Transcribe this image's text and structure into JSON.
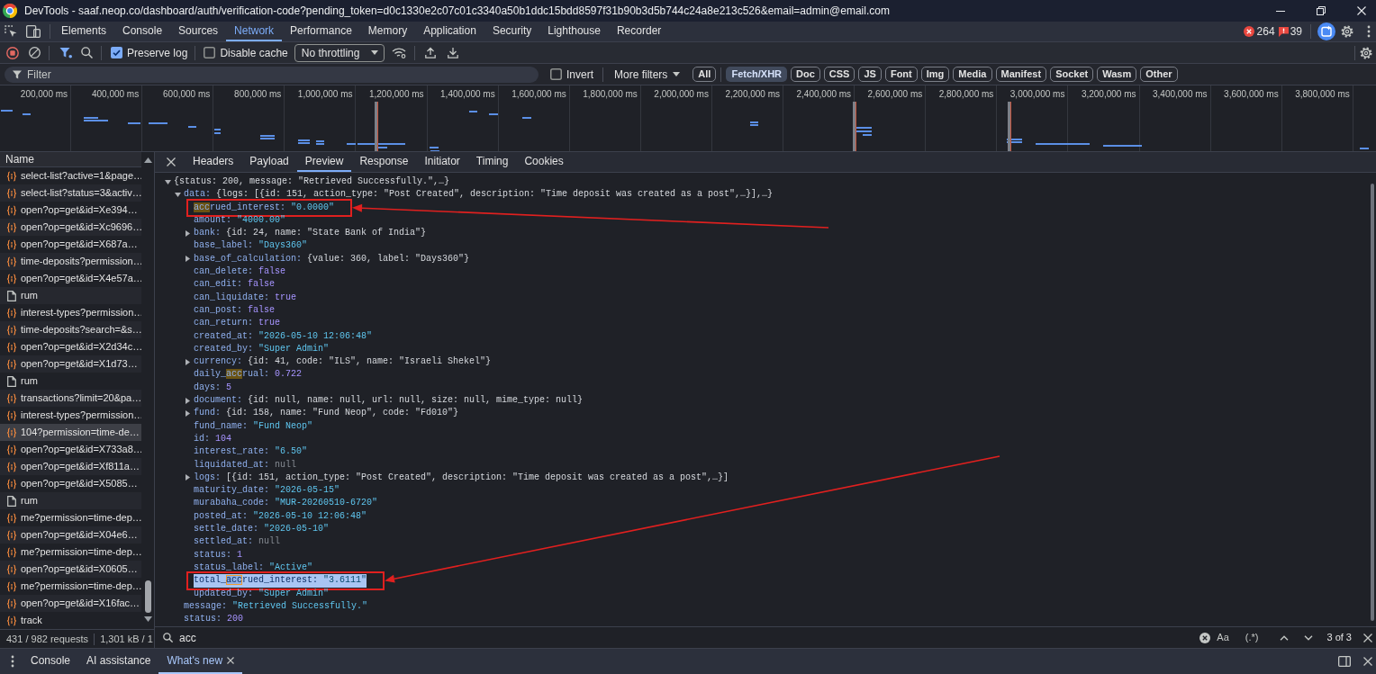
{
  "window": {
    "title": "DevTools - saaf.neop.co/dashboard/auth/verification-code?pending_token=d0c1330e2c07c01c3340a50b1ddc15bdd8597f31b90b3d5b744c24a8e213c526&email=admin@email.com"
  },
  "main_tabs": [
    {
      "label": "Elements",
      "selected": false
    },
    {
      "label": "Console",
      "selected": false
    },
    {
      "label": "Sources",
      "selected": false
    },
    {
      "label": "Network",
      "selected": true
    },
    {
      "label": "Performance",
      "selected": false
    },
    {
      "label": "Memory",
      "selected": false
    },
    {
      "label": "Application",
      "selected": false
    },
    {
      "label": "Security",
      "selected": false
    },
    {
      "label": "Lighthouse",
      "selected": false
    },
    {
      "label": "Recorder",
      "selected": false
    }
  ],
  "counts": {
    "errors": "264",
    "issues": "39"
  },
  "toolbar": {
    "preserve_log": {
      "label": "Preserve log",
      "checked": true
    },
    "disable_cache": {
      "label": "Disable cache",
      "checked": false
    },
    "throttling": "No throttling"
  },
  "filter_bar": {
    "filter": {
      "placeholder": "Filter"
    },
    "invert": {
      "label": "Invert",
      "checked": false
    },
    "more_filters": "More filters",
    "types": [
      {
        "label": "All",
        "selected": false
      },
      {
        "label": "Fetch/XHR",
        "selected": true
      },
      {
        "label": "Doc",
        "selected": false
      },
      {
        "label": "CSS",
        "selected": false
      },
      {
        "label": "JS",
        "selected": false
      },
      {
        "label": "Font",
        "selected": false
      },
      {
        "label": "Img",
        "selected": false
      },
      {
        "label": "Media",
        "selected": false
      },
      {
        "label": "Manifest",
        "selected": false
      },
      {
        "label": "Socket",
        "selected": false
      },
      {
        "label": "Wasm",
        "selected": false
      },
      {
        "label": "Other",
        "selected": false
      }
    ]
  },
  "timeline": {
    "ticks": [
      "200,000 ms",
      "400,000 ms",
      "600,000 ms",
      "800,000 ms",
      "1,000,000 ms",
      "1,200,000 ms",
      "1,400,000 ms",
      "1,600,000 ms",
      "1,800,000 ms",
      "2,000,000 ms",
      "2,200,000 ms",
      "2,400,000 ms",
      "2,600,000 ms",
      "2,800,000 ms",
      "3,000,000 ms",
      "3,200,000 ms",
      "3,400,000 ms",
      "3,600,000 ms",
      "3,800,000 ms"
    ]
  },
  "requests": {
    "column": "Name",
    "rows": [
      {
        "name": "select-list?active=1&page…",
        "kind": "fetch",
        "selected": false
      },
      {
        "name": "select-list?status=3&activ…",
        "kind": "fetch",
        "selected": false
      },
      {
        "name": "open?op=get&id=Xe394…",
        "kind": "fetch",
        "selected": false
      },
      {
        "name": "open?op=get&id=Xc9696…",
        "kind": "fetch",
        "selected": false
      },
      {
        "name": "open?op=get&id=X687a…",
        "kind": "fetch",
        "selected": false
      },
      {
        "name": "time-deposits?permission…",
        "kind": "fetch",
        "selected": false
      },
      {
        "name": "open?op=get&id=X4e57a…",
        "kind": "fetch",
        "selected": false
      },
      {
        "name": "rum",
        "kind": "document",
        "selected": false
      },
      {
        "name": "interest-types?permission…",
        "kind": "fetch",
        "selected": false
      },
      {
        "name": "time-deposits?search=&s…",
        "kind": "fetch",
        "selected": false
      },
      {
        "name": "open?op=get&id=X2d34c…",
        "kind": "fetch",
        "selected": false
      },
      {
        "name": "open?op=get&id=X1d73…",
        "kind": "fetch",
        "selected": false
      },
      {
        "name": "rum",
        "kind": "document",
        "selected": false
      },
      {
        "name": "transactions?limit=20&pa…",
        "kind": "fetch",
        "selected": false
      },
      {
        "name": "interest-types?permission…",
        "kind": "fetch",
        "selected": false
      },
      {
        "name": "104?permission=time-de…",
        "kind": "fetch",
        "selected": true
      },
      {
        "name": "open?op=get&id=X733a8…",
        "kind": "fetch",
        "selected": false
      },
      {
        "name": "open?op=get&id=Xf811a…",
        "kind": "fetch",
        "selected": false
      },
      {
        "name": "open?op=get&id=X5085…",
        "kind": "fetch",
        "selected": false
      },
      {
        "name": "rum",
        "kind": "document",
        "selected": false
      },
      {
        "name": "me?permission=time-dep…",
        "kind": "fetch",
        "selected": false
      },
      {
        "name": "open?op=get&id=X04e6…",
        "kind": "fetch",
        "selected": false
      },
      {
        "name": "me?permission=time-dep…",
        "kind": "fetch",
        "selected": false
      },
      {
        "name": "open?op=get&id=X0605…",
        "kind": "fetch",
        "selected": false
      },
      {
        "name": "me?permission=time-dep…",
        "kind": "fetch",
        "selected": false
      },
      {
        "name": "open?op=get&id=X16fac…",
        "kind": "fetch",
        "selected": false
      },
      {
        "name": "track",
        "kind": "fetch",
        "selected": false
      }
    ]
  },
  "status_bar": {
    "requests": "431 / 982 requests",
    "transferred": "1,301 kB / 1"
  },
  "detail": {
    "tabs": [
      {
        "label": "Headers",
        "selected": false
      },
      {
        "label": "Payload",
        "selected": false
      },
      {
        "label": "Preview",
        "selected": true
      },
      {
        "label": "Response",
        "selected": false
      },
      {
        "label": "Initiator",
        "selected": false
      },
      {
        "label": "Timing",
        "selected": false
      },
      {
        "label": "Cookies",
        "selected": false
      }
    ],
    "preview": {
      "value": "{status: 200, message: \"Retrieved Successfully.\",…}",
      "kind": "object",
      "expanded": true,
      "selected": false,
      "boxed": false,
      "children": [
        {
          "key": "data:",
          "value": "{logs: [{id: 151, action_type: \"Post Created\", description: \"Time deposit was created as a post\",…}],…}",
          "kind": "object",
          "expanded": true,
          "selected": false,
          "boxed": false,
          "children": [
            {
              "key_parts": [
                {
                  "text": "acc",
                  "match": true,
                  "current": false
                },
                {
                  "text": "rued_interest:",
                  "match": false,
                  "current": false
                }
              ],
              "value": "\"0.0000\"",
              "kind": "string",
              "selected": false,
              "boxed": true
            },
            {
              "key": "amount:",
              "value": "\"4000.00\"",
              "kind": "string",
              "selected": false,
              "boxed": false
            },
            {
              "key": "bank:",
              "value": "{id: 24, name: \"State Bank of India\"}",
              "kind": "object",
              "expanded": false,
              "selected": false,
              "boxed": false
            },
            {
              "key": "base_label:",
              "value": "\"Days360\"",
              "kind": "string",
              "selected": false,
              "boxed": false
            },
            {
              "key": "base_of_calculation:",
              "value": "{value: 360, label: \"Days360\"}",
              "kind": "object",
              "expanded": false,
              "selected": false,
              "boxed": false
            },
            {
              "key": "can_delete:",
              "value": "false",
              "kind": "boolean",
              "selected": false,
              "boxed": false
            },
            {
              "key": "can_edit:",
              "value": "false",
              "kind": "boolean",
              "selected": false,
              "boxed": false
            },
            {
              "key": "can_liquidate:",
              "value": "true",
              "kind": "boolean",
              "selected": false,
              "boxed": false
            },
            {
              "key": "can_post:",
              "value": "false",
              "kind": "boolean",
              "selected": false,
              "boxed": false
            },
            {
              "key": "can_return:",
              "value": "true",
              "kind": "boolean",
              "selected": false,
              "boxed": false
            },
            {
              "key": "created_at:",
              "value": "\"2026-05-10 12:06:48\"",
              "kind": "string",
              "selected": false,
              "boxed": false
            },
            {
              "key": "created_by:",
              "value": "\"Super Admin\"",
              "kind": "string",
              "selected": false,
              "boxed": false
            },
            {
              "key": "currency:",
              "value": "{id: 41, code: \"ILS\", name: \"Israeli Shekel\"}",
              "kind": "object",
              "expanded": false,
              "selected": false,
              "boxed": false
            },
            {
              "key_parts": [
                {
                  "text": "daily_",
                  "match": false,
                  "current": false
                },
                {
                  "text": "acc",
                  "match": true,
                  "current": false
                },
                {
                  "text": "rual:",
                  "match": false,
                  "current": false
                }
              ],
              "value": "0.722",
              "kind": "number",
              "selected": false,
              "boxed": false
            },
            {
              "key": "days:",
              "value": "5",
              "kind": "number",
              "selected": false,
              "boxed": false
            },
            {
              "key": "document:",
              "value": "{id: null, name: null, url: null, size: null, mime_type: null}",
              "kind": "object",
              "expanded": false,
              "selected": false,
              "boxed": false
            },
            {
              "key": "fund:",
              "value": "{id: 158, name: \"Fund Neop\", code: \"Fd010\"}",
              "kind": "object",
              "expanded": false,
              "selected": false,
              "boxed": false
            },
            {
              "key": "fund_name:",
              "value": "\"Fund Neop\"",
              "kind": "string",
              "selected": false,
              "boxed": false
            },
            {
              "key": "id:",
              "value": "104",
              "kind": "number",
              "selected": false,
              "boxed": false
            },
            {
              "key": "interest_rate:",
              "value": "\"6.50\"",
              "kind": "string",
              "selected": false,
              "boxed": false
            },
            {
              "key": "liquidated_at:",
              "value": "null",
              "kind": "null",
              "selected": false,
              "boxed": false
            },
            {
              "key": "logs:",
              "value": "[{id: 151, action_type: \"Post Created\", description: \"Time deposit was created as a post\",…}]",
              "kind": "object",
              "expanded": false,
              "selected": false,
              "boxed": false
            },
            {
              "key": "maturity_date:",
              "value": "\"2026-05-15\"",
              "kind": "string",
              "selected": false,
              "boxed": false
            },
            {
              "key": "murabaha_code:",
              "value": "\"MUR-20260510-6720\"",
              "kind": "string",
              "selected": false,
              "boxed": false
            },
            {
              "key": "posted_at:",
              "value": "\"2026-05-10 12:06:48\"",
              "kind": "string",
              "selected": false,
              "boxed": false
            },
            {
              "key": "settle_date:",
              "value": "\"2026-05-10\"",
              "kind": "string",
              "selected": false,
              "boxed": false
            },
            {
              "key": "settled_at:",
              "value": "null",
              "kind": "null",
              "selected": false,
              "boxed": false
            },
            {
              "key": "status:",
              "value": "1",
              "kind": "number",
              "selected": false,
              "boxed": false
            },
            {
              "key": "status_label:",
              "value": "\"Active\"",
              "kind": "string",
              "selected": false,
              "boxed": false
            },
            {
              "key_parts": [
                {
                  "text": "total_",
                  "match": false,
                  "current": false
                },
                {
                  "text": "acc",
                  "match": true,
                  "current": true
                },
                {
                  "text": "rued_interest:",
                  "match": false,
                  "current": false
                }
              ],
              "value": "\"3.6111\"",
              "kind": "string",
              "selected": true,
              "boxed": true
            },
            {
              "key": "updated_by:",
              "value": "\"Super Admin\"",
              "kind": "string",
              "selected": false,
              "boxed": false
            }
          ]
        },
        {
          "key": "message:",
          "value": "\"Retrieved Successfully.\"",
          "kind": "string",
          "selected": false,
          "boxed": false
        },
        {
          "key": "status:",
          "value": "200",
          "kind": "number",
          "selected": false,
          "boxed": false
        }
      ]
    }
  },
  "search": {
    "query": "acc",
    "match_case": "Aa",
    "regex": "(.*)",
    "result": "3 of 3"
  },
  "drawer": {
    "tabs": [
      {
        "label": "Console",
        "selected": false,
        "closable": false
      },
      {
        "label": "AI assistance",
        "selected": false,
        "closable": false
      },
      {
        "label": "What's new",
        "selected": true,
        "closable": true
      }
    ]
  }
}
